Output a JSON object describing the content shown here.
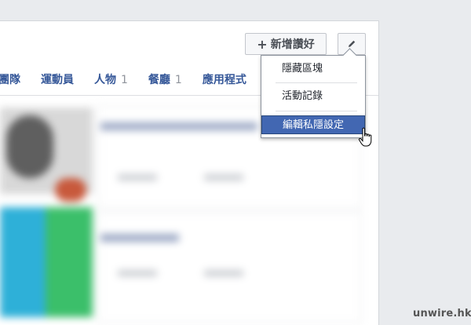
{
  "toolbar": {
    "add_favorites_label": "新增讚好",
    "add_icon": "plus-icon",
    "edit_icon": "pencil-icon"
  },
  "tabs": [
    {
      "label": "團隊",
      "count": ""
    },
    {
      "label": "運動員",
      "count": ""
    },
    {
      "label": "人物",
      "count": "1"
    },
    {
      "label": "餐廳",
      "count": "1"
    },
    {
      "label": "應用程式",
      "count": ""
    }
  ],
  "dropdown": {
    "items": [
      {
        "label": "隱藏區塊"
      },
      {
        "label": "活動記錄"
      },
      {
        "label": "編輯私隱設定",
        "highlighted": true
      }
    ]
  },
  "watermark": "unwire.hk",
  "colors": {
    "link": "#365899",
    "highlight": "#4267b2",
    "page_bg": "#e9ebee"
  }
}
